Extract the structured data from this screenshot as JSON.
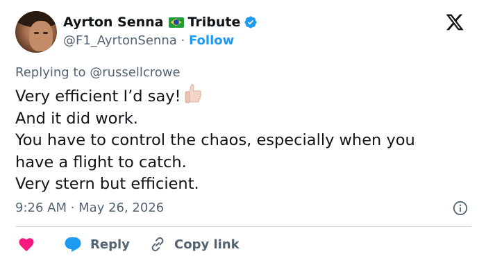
{
  "author": {
    "name_part1": "Ayrton Senna",
    "name_part2": "Tribute",
    "handle": "@F1_AyrtonSenna",
    "separator": "·",
    "follow_label": "Follow"
  },
  "icons": {
    "flag": "brazil-flag-icon",
    "verified": "verified-badge-icon",
    "platform": "x-logo-icon",
    "emoji": "thumbs-up-icon",
    "info": "info-icon",
    "like": "heart-icon",
    "reply": "reply-bubble-icon",
    "copy": "link-icon"
  },
  "colors": {
    "accent": "#1d9bf0",
    "like": "#f91880",
    "text": "#0f1419",
    "muted": "#536471"
  },
  "tweet": {
    "replying_to": "Replying to @russellcrowe",
    "lines": [
      "Very efficient I’d say!",
      "And it did work.",
      "You have to control the chaos, especially when you",
      "have a flight to catch.",
      "Very stern but efficient."
    ],
    "timestamp": "9:26 AM · May 26, 2026"
  },
  "actions": {
    "reply_label": "Reply",
    "copy_label": "Copy link"
  }
}
